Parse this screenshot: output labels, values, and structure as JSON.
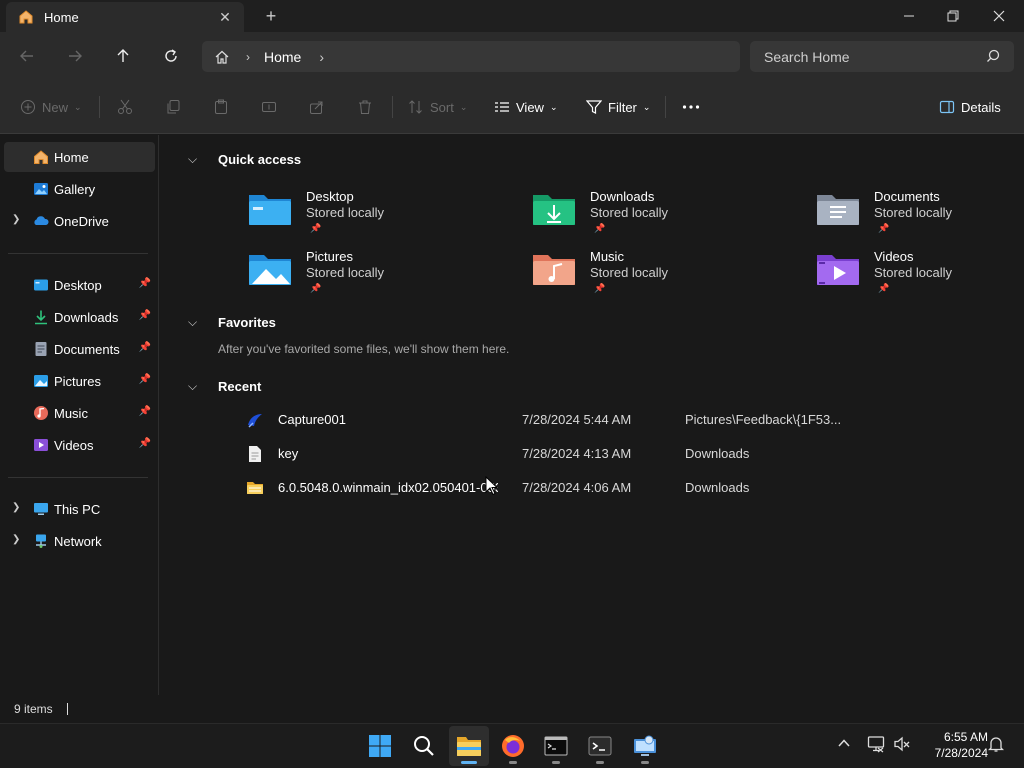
{
  "window": {
    "tab_title": "Home",
    "minimize_label": "—",
    "maximize_label": "❐",
    "close_label": "✕"
  },
  "nav": {
    "breadcrumb": [
      "Home"
    ],
    "search_placeholder": "Search Home"
  },
  "commandbar": {
    "new": "New",
    "sort": "Sort",
    "view": "View",
    "filter": "Filter",
    "details": "Details"
  },
  "sidebar": {
    "top": [
      {
        "label": "Home",
        "icon": "home-icon",
        "selected": true
      },
      {
        "label": "Gallery",
        "icon": "gallery-icon"
      },
      {
        "label": "OneDrive",
        "icon": "onedrive-icon",
        "expandable": true
      }
    ],
    "pinned": [
      {
        "label": "Desktop",
        "icon": "desktop-folder-icon"
      },
      {
        "label": "Downloads",
        "icon": "downloads-icon"
      },
      {
        "label": "Documents",
        "icon": "documents-icon"
      },
      {
        "label": "Pictures",
        "icon": "pictures-icon"
      },
      {
        "label": "Music",
        "icon": "music-icon"
      },
      {
        "label": "Videos",
        "icon": "videos-icon"
      }
    ],
    "bottom": [
      {
        "label": "This PC",
        "icon": "pc-icon",
        "expandable": true
      },
      {
        "label": "Network",
        "icon": "network-icon",
        "expandable": true
      }
    ]
  },
  "main": {
    "quick_access": {
      "title": "Quick access",
      "items": [
        {
          "name": "Desktop",
          "sub": "Stored locally",
          "icon": "desktop-folder-icon"
        },
        {
          "name": "Downloads",
          "sub": "Stored locally",
          "icon": "downloads-folder-icon"
        },
        {
          "name": "Documents",
          "sub": "Stored locally",
          "icon": "documents-folder-icon"
        },
        {
          "name": "Pictures",
          "sub": "Stored locally",
          "icon": "pictures-folder-icon"
        },
        {
          "name": "Music",
          "sub": "Stored locally",
          "icon": "music-folder-icon"
        },
        {
          "name": "Videos",
          "sub": "Stored locally",
          "icon": "videos-folder-icon"
        }
      ]
    },
    "favorites": {
      "title": "Favorites",
      "message": "After you've favorited some files, we'll show them here."
    },
    "recent": {
      "title": "Recent",
      "items": [
        {
          "name": "Capture001",
          "date": "7/28/2024 5:44 AM",
          "location": "Pictures\\Feedback\\{1F53...",
          "icon": "capture-file-icon"
        },
        {
          "name": "key",
          "date": "7/28/2024 4:13 AM",
          "location": "Downloads",
          "icon": "text-file-icon"
        },
        {
          "name": "6.0.5048.0.winmain_idx02.050401-0536_...",
          "date": "7/28/2024 4:06 AM",
          "location": "Downloads",
          "icon": "folder-icon"
        }
      ]
    }
  },
  "status": {
    "item_count": "9 items"
  },
  "taskbar": {
    "time": "6:55 AM",
    "date": "7/28/2024"
  },
  "colors": {
    "background": "#191919",
    "toolbar": "#2b2b2b",
    "accent": "#5fb2f2"
  }
}
